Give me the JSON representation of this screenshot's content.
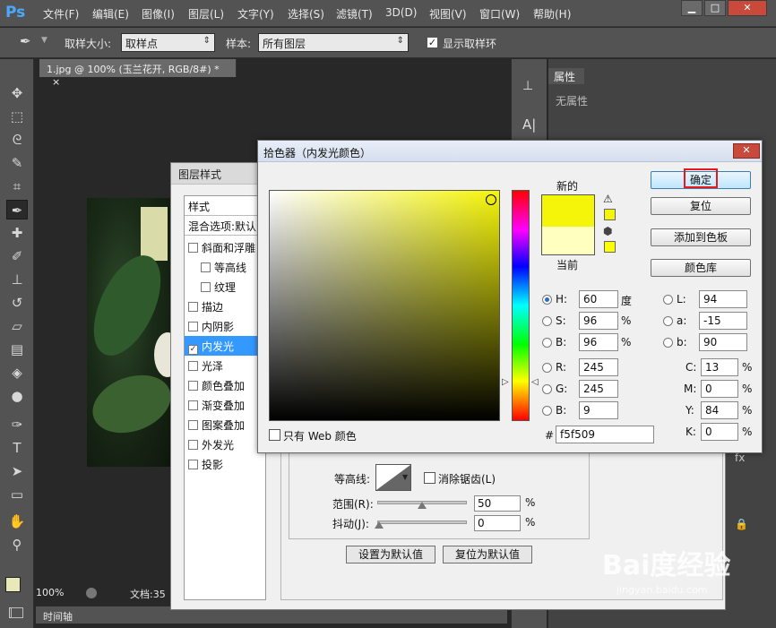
{
  "app": {
    "logo": "Ps"
  },
  "menu": [
    "文件(F)",
    "编辑(E)",
    "图像(I)",
    "图层(L)",
    "文字(Y)",
    "选择(S)",
    "滤镜(T)",
    "3D(D)",
    "视图(V)",
    "窗口(W)",
    "帮助(H)"
  ],
  "options": {
    "sample_size_label": "取样大小:",
    "sample_size_value": "取样点",
    "sample_label": "样本:",
    "sample_value": "所有图层",
    "show_ring_label": "显示取样环"
  },
  "document": {
    "tab_title": "1.jpg @ 100% (玉兰花开, RGB/8#) *",
    "tab_close": "×",
    "zoom": "100%",
    "doc_info": "文档:35"
  },
  "timeline": {
    "label": "时间轴"
  },
  "properties": {
    "tab": "属性",
    "empty": "无属性"
  },
  "layer_style": {
    "title": "图层样式",
    "list_header": "样式",
    "blend_options": "混合选项:默认",
    "items": [
      {
        "label": "斜面和浮雕",
        "checked": false,
        "indent": false
      },
      {
        "label": "等高线",
        "checked": false,
        "indent": true
      },
      {
        "label": "纹理",
        "checked": false,
        "indent": true
      },
      {
        "label": "描边",
        "checked": false,
        "indent": false
      },
      {
        "label": "内阴影",
        "checked": false,
        "indent": false
      },
      {
        "label": "内发光",
        "checked": true,
        "indent": false,
        "selected": true
      },
      {
        "label": "光泽",
        "checked": false,
        "indent": false
      },
      {
        "label": "颜色叠加",
        "checked": false,
        "indent": false
      },
      {
        "label": "渐变叠加",
        "checked": false,
        "indent": false
      },
      {
        "label": "图案叠加",
        "checked": false,
        "indent": false
      },
      {
        "label": "外发光",
        "checked": false,
        "indent": false
      },
      {
        "label": "投影",
        "checked": false,
        "indent": false
      }
    ],
    "contour_label": "等高线:",
    "antialias_label": "消除锯齿(L)",
    "range_label": "范围(R):",
    "range_value": "50",
    "jitter_label": "抖动(J):",
    "jitter_value": "0",
    "percent": "%",
    "make_default": "设置为默认值",
    "reset_default": "复位为默认值"
  },
  "color_picker": {
    "title": "拾色器（内发光颜色）",
    "close": "✕",
    "new_label": "新的",
    "current_label": "当前",
    "new_color": "#f5f509",
    "current_color": "#ffffc0",
    "only_web_label": "只有 Web 颜色",
    "buttons": {
      "ok": "确定",
      "reset": "复位",
      "add_swatch": "添加到色板",
      "libraries": "颜色库"
    },
    "fields": {
      "H": {
        "label": "H:",
        "value": "60",
        "unit": "度"
      },
      "S": {
        "label": "S:",
        "value": "96",
        "unit": "%"
      },
      "B": {
        "label": "B:",
        "value": "96",
        "unit": "%"
      },
      "R": {
        "label": "R:",
        "value": "245"
      },
      "G": {
        "label": "G:",
        "value": "245"
      },
      "Bb": {
        "label": "B:",
        "value": "9"
      },
      "L": {
        "label": "L:",
        "value": "94"
      },
      "a": {
        "label": "a:",
        "value": "-15"
      },
      "b": {
        "label": "b:",
        "value": "90"
      },
      "C": {
        "label": "C:",
        "value": "13",
        "unit": "%"
      },
      "M": {
        "label": "M:",
        "value": "0",
        "unit": "%"
      },
      "Y": {
        "label": "Y:",
        "value": "84",
        "unit": "%"
      },
      "K": {
        "label": "K:",
        "value": "0",
        "unit": "%"
      }
    },
    "hex_label": "#",
    "hex_value": "f5f509"
  },
  "watermark": {
    "brand": "Bai度经验",
    "sub": "jingyan.baidu.com"
  }
}
